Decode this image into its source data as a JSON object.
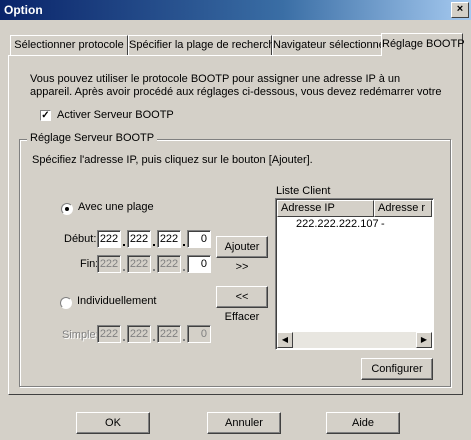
{
  "window": {
    "title": "Option",
    "close_glyph": "×"
  },
  "tabs": [
    {
      "label": "Sélectionner protocole",
      "active": false
    },
    {
      "label": "Spécifier la plage de recherche",
      "active": false
    },
    {
      "label": "Navigateur sélectionné",
      "active": false
    },
    {
      "label": "Réglage BOOTP",
      "active": true
    }
  ],
  "intro": {
    "line1": "Vous pouvez utiliser le protocole BOOTP pour assigner une adresse IP à un",
    "line2": "appareil. Après avoir procédé aux réglages ci-dessous, vous devez redémarrer votre"
  },
  "activate": {
    "label": "Activer Serveur BOOTP",
    "checked": true,
    "check_glyph": "✓"
  },
  "group": {
    "label": "Réglage Serveur BOOTP",
    "instruction": "Spécifiez l'adresse IP, puis cliquez sur le bouton [Ajouter]."
  },
  "range": {
    "radio_label": "Avec une plage",
    "selected": true,
    "start_label": "Début:",
    "start": [
      "222",
      "222",
      "222",
      "0"
    ],
    "end_label": "Fin:",
    "end": [
      "222",
      "222",
      "222",
      "0"
    ]
  },
  "individual": {
    "radio_label": "Individuellement",
    "selected": false,
    "simple_label": "Simple:",
    "simple": [
      "222",
      "222",
      "222",
      "0"
    ]
  },
  "buttons": {
    "add": "Ajouter >>",
    "delete": "<< Effacer",
    "configure": "Configurer",
    "ok": "OK",
    "cancel": "Annuler",
    "help": "Aide"
  },
  "client_list": {
    "title": "Liste Client",
    "columns": [
      "Adresse IP",
      "Adresse r"
    ],
    "rows": [
      {
        "ip": "222.222.222.107",
        "mac": "-"
      }
    ]
  }
}
